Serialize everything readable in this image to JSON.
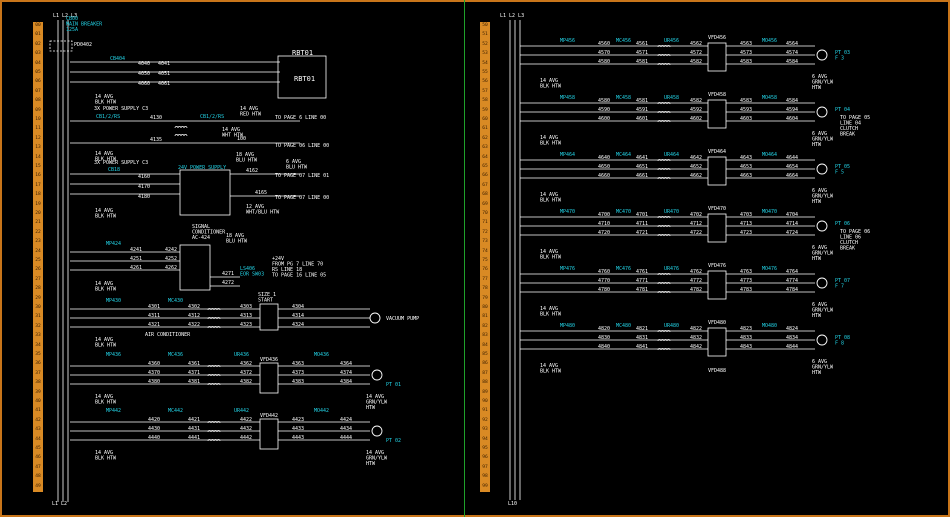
{
  "left_rows": [
    "00",
    "01",
    "02",
    "03",
    "04",
    "05",
    "06",
    "07",
    "08",
    "09",
    "10",
    "11",
    "12",
    "13",
    "14",
    "15",
    "16",
    "17",
    "18",
    "19",
    "20",
    "21",
    "22",
    "23",
    "24",
    "25",
    "26",
    "27",
    "28",
    "29",
    "30",
    "31",
    "32",
    "33",
    "34",
    "35",
    "36",
    "37",
    "38",
    "39",
    "40",
    "41",
    "42",
    "43",
    "44",
    "45",
    "46",
    "47",
    "48",
    "49"
  ],
  "right_rows": [
    "50",
    "51",
    "52",
    "53",
    "54",
    "55",
    "56",
    "57",
    "58",
    "59",
    "60",
    "61",
    "62",
    "63",
    "64",
    "65",
    "66",
    "67",
    "68",
    "69",
    "70",
    "71",
    "72",
    "73",
    "74",
    "75",
    "76",
    "77",
    "78",
    "79",
    "80",
    "81",
    "82",
    "83",
    "84",
    "85",
    "86",
    "87",
    "88",
    "89",
    "90",
    "91",
    "92",
    "93",
    "94",
    "95",
    "96",
    "97",
    "98",
    "99"
  ],
  "left": {
    "top_tags": [
      "L1",
      "L2",
      "L3"
    ],
    "main_breaker": [
      "CB00",
      "MAIN BREAKER",
      "125A"
    ],
    "disconnect": "PD0402",
    "rbt_box_label": "RBT01",
    "rbt_title": "RBT01",
    "cb_rbt": "CB404",
    "rbt_wires": [
      "4040",
      "4050",
      "4060"
    ],
    "rbt_out": [
      "4041",
      "4051",
      "4061"
    ],
    "wire_14awg": "14 AVG\nBLK HTW",
    "ps_label": "3X POWER SUPPLY C3",
    "cb_ps1": "CB1/2/RS",
    "cb_ps2": "CB1/2/RS",
    "ps_wires": [
      "4130",
      "4135"
    ],
    "ps_to1": "TO PAGE 6 LINE 00",
    "ps_to2": "TO PAGE 06 LINE 00",
    "ps_awg": "14 AVG\nRED HTW",
    "ps_awg2": "14 AVG\nWHT HTW",
    "ps_n": "100",
    "ps_awg3": "18 AVG\nBLU HTW",
    "supply24_label": "3X POWER SUPPLY C3",
    "cb_24": "CB18",
    "supply24_title": "24V POWER SUPPLY",
    "wires_24": [
      "4160",
      "4170",
      "4180"
    ],
    "out_24": [
      "4162",
      "4165"
    ],
    "to_24": "TO PAGE 07 LINE 01",
    "to_24b": "TO PAGE 07 LINE 00",
    "awg_24": "6 AVG\nBLU HTW",
    "awg_24b": "12 AVG\nWHT/BLU HTW",
    "cond_title": "SIGNAL\nCONDITIONER\nAC-424",
    "awg_cond": "18 AVG\nBLU HTW",
    "mp_cond": "MP424",
    "cond_wires": [
      "4241",
      "4251",
      "4261"
    ],
    "cond_out": [
      "4242",
      "4252",
      "4262"
    ],
    "cond_sig": [
      "4271",
      "4272"
    ],
    "cond_to": "+24V\nFROM PG 7 LINE 70\nRS LINE 18\nTO PAGE 16 LINE 05",
    "cond_mark": "LS406\nEOR SW03",
    "vac_motor_label": "VACUUM PUMP",
    "vac_mp": "MP430",
    "vac_mc": "MC430",
    "vac_wires": [
      "4300",
      "4310",
      "4320",
      "4330"
    ],
    "vac_in": [
      "4301",
      "4311",
      "4321"
    ],
    "vac_out": [
      "4302",
      "4312",
      "4322"
    ],
    "vac_mot": [
      "4303",
      "4313",
      "4323"
    ],
    "vac_ctl": "SIZE 1\nSTART",
    "vac_out2": [
      "4304",
      "4314",
      "4324"
    ],
    "vac_note": "AIR CONDITIONER",
    "vfd_rows": [
      {
        "mp": "MP436",
        "mc": "MC436",
        "vfd": "VFD436",
        "w1": [
          "4360",
          "4370",
          "4380"
        ],
        "w2": [
          "4361",
          "4371",
          "4381"
        ],
        "w3": [
          "4362",
          "4372",
          "4382"
        ],
        "w4": [
          "4363",
          "4373",
          "4383"
        ],
        "w5": [
          "4364",
          "4374",
          "4384"
        ],
        "mot": "PT 01"
      },
      {
        "mp": "MP442",
        "mc": "MC442",
        "vfd": "VFD442",
        "w1": [
          "4420",
          "4430",
          "4440"
        ],
        "w2": [
          "4421",
          "4431",
          "4441"
        ],
        "w3": [
          "4422",
          "4432",
          "4442"
        ],
        "w4": [
          "4423",
          "4433",
          "4443"
        ],
        "w5": [
          "4424",
          "4434",
          "4444"
        ],
        "mot": "PT 02"
      }
    ],
    "motor_awg": "14 AVG\nGRN/YLW\nHTW"
  },
  "right": {
    "top_tags": [
      "L1",
      "L2",
      "L3"
    ],
    "rows": [
      {
        "mp": "MP456",
        "mc": "MC456",
        "vfd": "VFD456",
        "w1": [
          "4560",
          "4570",
          "4580"
        ],
        "w2": [
          "4561",
          "4571",
          "4581"
        ],
        "w3": [
          "4562",
          "4572",
          "4582"
        ],
        "w4": [
          "4563",
          "4573",
          "4583"
        ],
        "w5": [
          "4564",
          "4574",
          "4584"
        ],
        "mot": "PT 03\nF 3",
        "note": ""
      },
      {
        "mp": "MP458",
        "mc": "MC458",
        "vfd": "VFD458",
        "w1": [
          "4580",
          "4590",
          "4600"
        ],
        "w2": [
          "4581",
          "4591",
          "4601"
        ],
        "w3": [
          "4582",
          "4592",
          "4602"
        ],
        "w4": [
          "4583",
          "4593",
          "4603"
        ],
        "w5": [
          "4584",
          "4594",
          "4604"
        ],
        "mot": "PT 04",
        "note": "TO PAGE 05\nLINE 04\nCLUTCH\nBREAK"
      },
      {
        "mp": "MP464",
        "mc": "MC464",
        "vfd": "VFD464",
        "w1": [
          "4640",
          "4650",
          "4660"
        ],
        "w2": [
          "4641",
          "4651",
          "4661"
        ],
        "w3": [
          "4642",
          "4652",
          "4662"
        ],
        "w4": [
          "4643",
          "4653",
          "4663"
        ],
        "w5": [
          "4644",
          "4654",
          "4664"
        ],
        "mot": "PT 05\nF 5",
        "note": ""
      },
      {
        "mp": "MP470",
        "mc": "MC470",
        "vfd": "VFD470",
        "w1": [
          "4700",
          "4710",
          "4720"
        ],
        "w2": [
          "4701",
          "4711",
          "4721"
        ],
        "w3": [
          "4702",
          "4712",
          "4722"
        ],
        "w4": [
          "4703",
          "4713",
          "4723"
        ],
        "w5": [
          "4704",
          "4714",
          "4724"
        ],
        "mot": "PT 06",
        "note": "TO PAGE 06\nLINE 06\nCLUTCH\nBREAK"
      },
      {
        "mp": "MP476",
        "mc": "MC476",
        "vfd": "VFD476",
        "w1": [
          "4760",
          "4770",
          "4780"
        ],
        "w2": [
          "4761",
          "4771",
          "4781"
        ],
        "w3": [
          "4762",
          "4772",
          "4782"
        ],
        "w4": [
          "4763",
          "4773",
          "4783"
        ],
        "w5": [
          "4764",
          "4774",
          "4784"
        ],
        "mot": "PT 07\nF 7",
        "note": ""
      },
      {
        "mp": "MP480",
        "mc": "MC480",
        "vfd": "VFD480",
        "w1": [
          "4820",
          "4830",
          "4840"
        ],
        "w2": [
          "4821",
          "4831",
          "4841"
        ],
        "w3": [
          "4822",
          "4832",
          "4842"
        ],
        "w4": [
          "4823",
          "4833",
          "4843"
        ],
        "w5": [
          "4824",
          "4834",
          "4844"
        ],
        "mot": "PT 08\nF 8",
        "note": ""
      }
    ],
    "bottom_vfd": "VFD488",
    "motor_awg": "6 AVG\nGRN/YLW\nHTW",
    "end_tag": "L10"
  }
}
